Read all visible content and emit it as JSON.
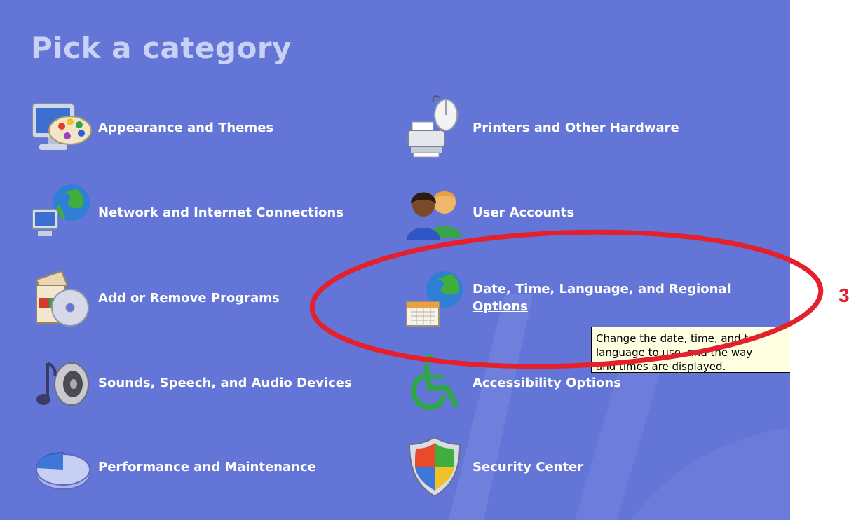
{
  "panel": {
    "background": "#6375d6",
    "title": "Pick a category"
  },
  "categories": [
    {
      "label": "Appearance and Themes",
      "icon": "appearance-themes-icon"
    },
    {
      "label": "Printers and Other Hardware",
      "icon": "printer-hardware-icon"
    },
    {
      "label": "Network and Internet Connections",
      "icon": "network-connections-icon"
    },
    {
      "label": "User Accounts",
      "icon": "user-accounts-icon"
    },
    {
      "label": "Add or Remove Programs",
      "icon": "add-remove-programs-icon"
    },
    {
      "label": "Date, Time, Language, and Regional Options",
      "icon": "date-time-globe-icon",
      "hovered": true
    },
    {
      "label": "Sounds, Speech, and Audio Devices",
      "icon": "speaker-audio-icon"
    },
    {
      "label": "Accessibility Options",
      "icon": "accessibility-icon"
    },
    {
      "label": "Performance and Maintenance",
      "icon": "pie-chart-performance-icon"
    },
    {
      "label": "Security Center",
      "icon": "security-shield-icon"
    }
  ],
  "tooltip": {
    "lines": [
      "Change the date, time, and t",
      "language to use, and the way",
      "and times are displayed."
    ]
  },
  "annotation": {
    "number": "3",
    "color": "#e4202c"
  }
}
